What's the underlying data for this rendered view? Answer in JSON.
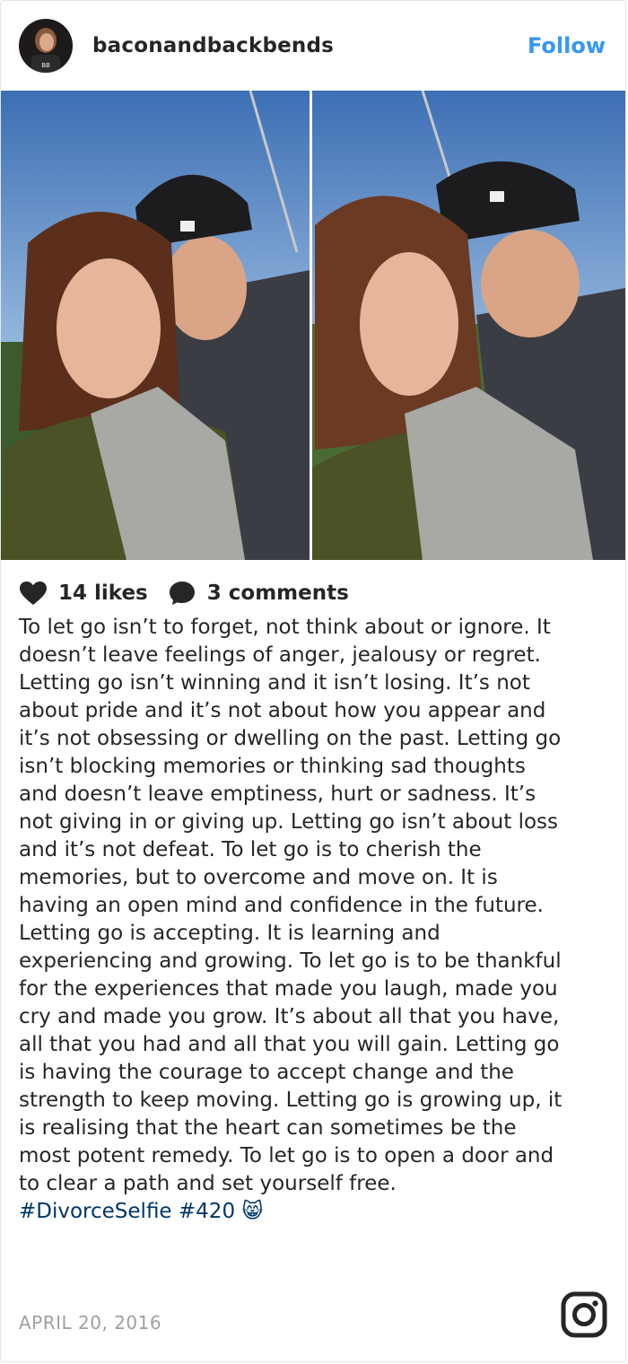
{
  "post": {
    "username": "baconandbackbends",
    "follow_label": "Follow",
    "likes_label": "14 likes",
    "comments_label": "3 comments",
    "caption": "To let go isn’t to forget, not think about or ignore. It doesn’t leave feelings of anger, jealousy or regret. Letting go isn’t winning and it isn’t losing. It’s not about pride and it’s not about how you appear and it’s not obsessing or dwelling on the past. Letting go isn’t blocking memories or thinking sad thoughts and doesn’t leave emptiness, hurt or sadness. It’s not giving in or giving up. Letting go isn’t about loss and it’s not defeat. To let go is to cherish the memories, but to overcome and move on. It is having an open mind and confidence in the future. Letting go is accepting. It is learning and experiencing and growing. To let go is to be thankful for the experiences that made you laugh, made you cry and made you grow. It’s about all that you have, all that you had and all that you will gain. Letting go is having the courage to accept change and the strength to keep moving. Letting go is growing up, it is realising that the heart can sometimes be the most potent remedy. To let go is to open a door and to clear a path and set yourself free.",
    "hashtag_1": "#DivorceSelfie",
    "hashtag_2": "#420",
    "emoji": "😸",
    "date": "APRIL 20, 2016"
  },
  "icons": {
    "like": "heart-icon",
    "comment": "comment-bubble-icon",
    "brand": "instagram-logo-icon"
  },
  "colors": {
    "follow": "#3897f0",
    "hashtag": "#003569",
    "date": "#a0a0a0"
  }
}
